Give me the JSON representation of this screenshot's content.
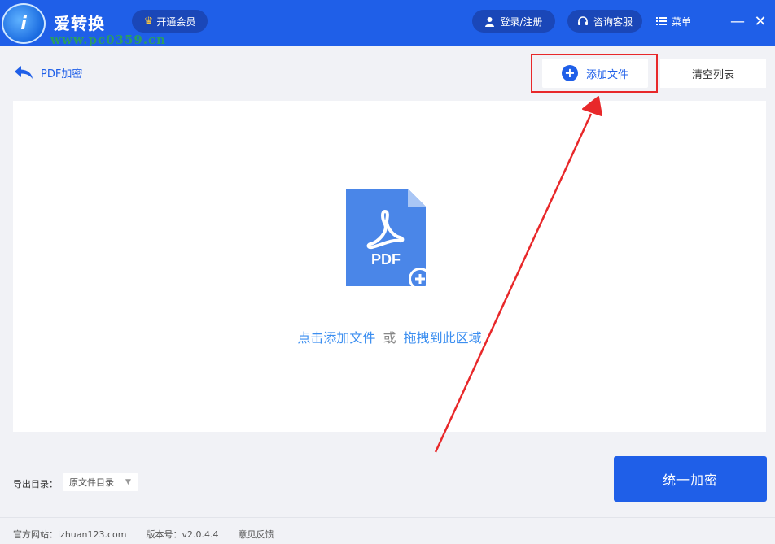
{
  "titlebar": {
    "app_name": "爱转换",
    "watermark": "www.pc0359.cn",
    "vip_label": "开通会员",
    "login_label": "登录/注册",
    "service_label": "咨询客服",
    "menu_label": "菜单",
    "minimize_glyph": "—",
    "close_glyph": "✕",
    "logo_text": "i"
  },
  "subheader": {
    "page_title": "PDF加密",
    "add_file_label": "添加文件",
    "clear_list_label": "清空列表"
  },
  "drop_area": {
    "file_icon_label": "PDF",
    "click_text": "点击添加文件",
    "or_text": "或",
    "drag_text": "拖拽到此区域"
  },
  "bottom": {
    "export_label": "导出目录：",
    "export_value": "原文件目录",
    "encrypt_label": "统一加密"
  },
  "footer": {
    "website": "官方网站：izhuan123.com",
    "version": "版本号：v2.0.4.4",
    "feedback": "意见反馈"
  },
  "colors": {
    "brand": "#1f5fe8",
    "annotation": "#e8282a",
    "link": "#3b8ef0"
  }
}
